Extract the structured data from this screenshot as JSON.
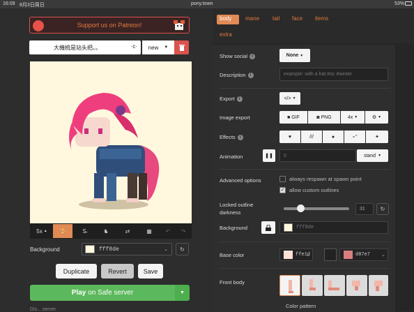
{
  "status_bar": {
    "time": "16:09",
    "date": "8月3日周日",
    "url": "pony.town",
    "battery": "53%"
  },
  "banner": {
    "label": "Support us on Patreon!"
  },
  "name_bar": {
    "value": "大機梳是站头把。。",
    "preset": "new"
  },
  "toolbar": {
    "zoom": "5x"
  },
  "background": {
    "label": "Background",
    "value": "fff8de",
    "color": "#fff8de"
  },
  "actions": {
    "duplicate": "Duplicate",
    "revert": "Revert",
    "save": "Save"
  },
  "play": {
    "prefix": "Play",
    "suffix": "on Safe server"
  },
  "bottom_cut": "Dis... server",
  "tabs": [
    "body",
    "mane",
    "tail",
    "face",
    "items",
    "extra"
  ],
  "settings": {
    "show_social": {
      "label": "Show social",
      "value": "None"
    },
    "description": {
      "label": "Description",
      "placeholder": "example: with a hat #oc #winter"
    },
    "export": {
      "label": "Export",
      "button": "</>"
    },
    "image_export": {
      "label": "Image export",
      "gif": "GIF",
      "png": "PNG",
      "scale": "4x"
    },
    "effects": {
      "label": "Effects"
    },
    "animation": {
      "label": "Animation",
      "value": "0",
      "select": "stand"
    },
    "advanced": {
      "label": "Advanced options",
      "opt1": "always respawn at spawn point",
      "opt2": "allow custom outlines"
    },
    "outline": {
      "label": "Locked outline darkness",
      "value": "31",
      "slider_level": 0.25
    },
    "background": {
      "label": "Background",
      "value": "fff8de",
      "color": "#fff8de"
    },
    "base_color": {
      "label": "Base color",
      "value": "ffe1d",
      "outline": "d87e7",
      "color": "#ffe1d6",
      "outline_color": "#d87e7e"
    },
    "front_body": {
      "label": "Front body"
    },
    "color_pattern": {
      "label": "Color pattern"
    }
  },
  "colors": {
    "accent": "#e07a3e",
    "play": "#5cb85c",
    "delete": "#d9534f",
    "active_tab": "#e08a55"
  }
}
